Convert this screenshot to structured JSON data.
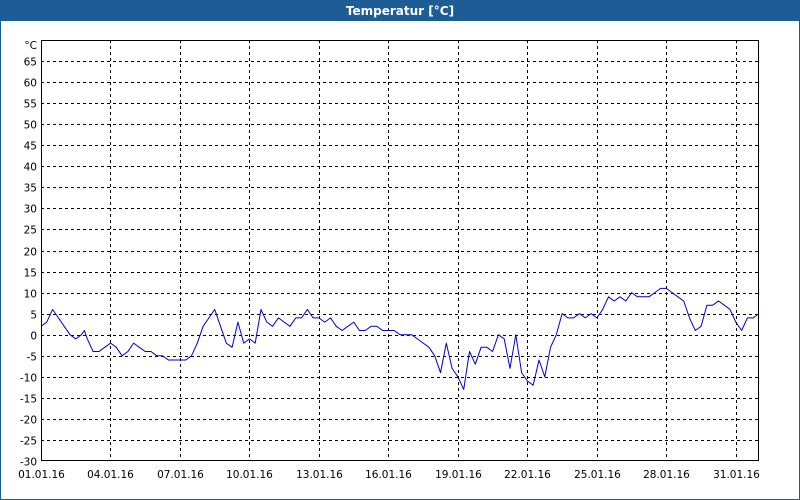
{
  "window": {
    "title": "Temperatur [°C]"
  },
  "chart_data": {
    "type": "line",
    "title": "Temperatur [°C]",
    "unit_label": "°C",
    "xlabel": "",
    "ylabel": "",
    "xlim": [
      "01.01.16 00:00",
      "01.02.16 00:00"
    ],
    "ylim": [
      -30,
      70
    ],
    "yticks": [
      65,
      60,
      55,
      50,
      45,
      40,
      35,
      30,
      25,
      20,
      15,
      10,
      5,
      0,
      -5,
      -10,
      -15,
      -20,
      -25,
      -30
    ],
    "xticks": [
      "01.01.16",
      "04.01.16",
      "07.01.16",
      "10.01.16",
      "13.01.16",
      "16.01.16",
      "19.01.16",
      "22.01.16",
      "25.01.16",
      "28.01.16",
      "31.01.16"
    ],
    "grid": true,
    "legend": "none",
    "series": [
      {
        "color": "#0000c8",
        "points": [
          [
            "01.01.16 00:00",
            2
          ],
          [
            "01.01.16 06:00",
            3
          ],
          [
            "01.01.16 12:00",
            6
          ],
          [
            "01.01.16 18:00",
            4
          ],
          [
            "02.01.16 00:00",
            2
          ],
          [
            "02.01.16 06:00",
            0
          ],
          [
            "02.01.16 12:00",
            -1
          ],
          [
            "02.01.16 18:00",
            0
          ],
          [
            "02.01.16 21:00",
            1
          ],
          [
            "03.01.16 00:00",
            -1
          ],
          [
            "03.01.16 06:00",
            -4
          ],
          [
            "03.01.16 12:00",
            -4
          ],
          [
            "03.01.16 18:00",
            -3
          ],
          [
            "04.01.16 00:00",
            -2
          ],
          [
            "04.01.16 06:00",
            -3
          ],
          [
            "04.01.16 12:00",
            -5
          ],
          [
            "04.01.16 18:00",
            -4
          ],
          [
            "05.01.16 00:00",
            -2
          ],
          [
            "05.01.16 06:00",
            -3
          ],
          [
            "05.01.16 12:00",
            -4
          ],
          [
            "05.01.16 18:00",
            -4
          ],
          [
            "06.01.16 00:00",
            -5
          ],
          [
            "06.01.16 06:00",
            -5
          ],
          [
            "06.01.16 12:00",
            -6
          ],
          [
            "06.01.16 18:00",
            -6
          ],
          [
            "07.01.16 00:00",
            -6
          ],
          [
            "07.01.16 06:00",
            -6
          ],
          [
            "07.01.16 12:00",
            -5
          ],
          [
            "07.01.16 18:00",
            -2
          ],
          [
            "08.01.16 00:00",
            2
          ],
          [
            "08.01.16 06:00",
            4
          ],
          [
            "08.01.16 12:00",
            6
          ],
          [
            "08.01.16 18:00",
            2
          ],
          [
            "09.01.16 00:00",
            -2
          ],
          [
            "09.01.16 06:00",
            -3
          ],
          [
            "09.01.16 12:00",
            3
          ],
          [
            "09.01.16 18:00",
            -2
          ],
          [
            "10.01.16 00:00",
            -1
          ],
          [
            "10.01.16 06:00",
            -2
          ],
          [
            "10.01.16 12:00",
            6
          ],
          [
            "10.01.16 18:00",
            3
          ],
          [
            "11.01.16 00:00",
            2
          ],
          [
            "11.01.16 06:00",
            4
          ],
          [
            "11.01.16 12:00",
            3
          ],
          [
            "11.01.16 18:00",
            2
          ],
          [
            "12.01.16 00:00",
            4
          ],
          [
            "12.01.16 06:00",
            4
          ],
          [
            "12.01.16 12:00",
            6
          ],
          [
            "12.01.16 18:00",
            4
          ],
          [
            "13.01.16 00:00",
            4
          ],
          [
            "13.01.16 06:00",
            3
          ],
          [
            "13.01.16 12:00",
            4
          ],
          [
            "13.01.16 18:00",
            2
          ],
          [
            "14.01.16 00:00",
            1
          ],
          [
            "14.01.16 06:00",
            2
          ],
          [
            "14.01.16 12:00",
            3
          ],
          [
            "14.01.16 18:00",
            1
          ],
          [
            "15.01.16 00:00",
            1
          ],
          [
            "15.01.16 06:00",
            2
          ],
          [
            "15.01.16 12:00",
            2
          ],
          [
            "15.01.16 18:00",
            1
          ],
          [
            "16.01.16 00:00",
            1
          ],
          [
            "16.01.16 06:00",
            1
          ],
          [
            "16.01.16 12:00",
            0
          ],
          [
            "16.01.16 18:00",
            0
          ],
          [
            "17.01.16 00:00",
            0
          ],
          [
            "17.01.16 06:00",
            -1
          ],
          [
            "17.01.16 12:00",
            -2
          ],
          [
            "17.01.16 18:00",
            -3
          ],
          [
            "18.01.16 00:00",
            -5
          ],
          [
            "18.01.16 06:00",
            -9
          ],
          [
            "18.01.16 12:00",
            -2
          ],
          [
            "18.01.16 18:00",
            -8
          ],
          [
            "19.01.16 00:00",
            -10
          ],
          [
            "19.01.16 06:00",
            -13
          ],
          [
            "19.01.16 12:00",
            -4
          ],
          [
            "19.01.16 18:00",
            -7
          ],
          [
            "20.01.16 00:00",
            -3
          ],
          [
            "20.01.16 06:00",
            -3
          ],
          [
            "20.01.16 12:00",
            -4
          ],
          [
            "20.01.16 18:00",
            0
          ],
          [
            "21.01.16 00:00",
            -1
          ],
          [
            "21.01.16 06:00",
            -8
          ],
          [
            "21.01.16 12:00",
            0
          ],
          [
            "21.01.16 18:00",
            -9
          ],
          [
            "22.01.16 00:00",
            -11
          ],
          [
            "22.01.16 06:00",
            -12
          ],
          [
            "22.01.16 12:00",
            -6
          ],
          [
            "22.01.16 18:00",
            -10
          ],
          [
            "23.01.16 00:00",
            -3
          ],
          [
            "23.01.16 06:00",
            0
          ],
          [
            "23.01.16 12:00",
            5
          ],
          [
            "23.01.16 18:00",
            4
          ],
          [
            "24.01.16 00:00",
            4
          ],
          [
            "24.01.16 06:00",
            5
          ],
          [
            "24.01.16 12:00",
            4
          ],
          [
            "24.01.16 18:00",
            5
          ],
          [
            "25.01.16 00:00",
            4
          ],
          [
            "25.01.16 06:00",
            6
          ],
          [
            "25.01.16 12:00",
            9
          ],
          [
            "25.01.16 18:00",
            8
          ],
          [
            "26.01.16 00:00",
            9
          ],
          [
            "26.01.16 06:00",
            8
          ],
          [
            "26.01.16 12:00",
            10
          ],
          [
            "26.01.16 18:00",
            9
          ],
          [
            "27.01.16 00:00",
            9
          ],
          [
            "27.01.16 06:00",
            9
          ],
          [
            "27.01.16 12:00",
            10
          ],
          [
            "27.01.16 18:00",
            11
          ],
          [
            "28.01.16 00:00",
            11
          ],
          [
            "28.01.16 06:00",
            10
          ],
          [
            "28.01.16 12:00",
            9
          ],
          [
            "28.01.16 18:00",
            8
          ],
          [
            "29.01.16 00:00",
            4
          ],
          [
            "29.01.16 06:00",
            1
          ],
          [
            "29.01.16 12:00",
            2
          ],
          [
            "29.01.16 18:00",
            7
          ],
          [
            "30.01.16 00:00",
            7
          ],
          [
            "30.01.16 06:00",
            8
          ],
          [
            "30.01.16 12:00",
            7
          ],
          [
            "30.01.16 18:00",
            6
          ],
          [
            "31.01.16 00:00",
            3
          ],
          [
            "31.01.16 06:00",
            1
          ],
          [
            "31.01.16 12:00",
            4
          ],
          [
            "31.01.16 18:00",
            4
          ],
          [
            "01.02.16 00:00",
            5
          ]
        ]
      }
    ]
  }
}
